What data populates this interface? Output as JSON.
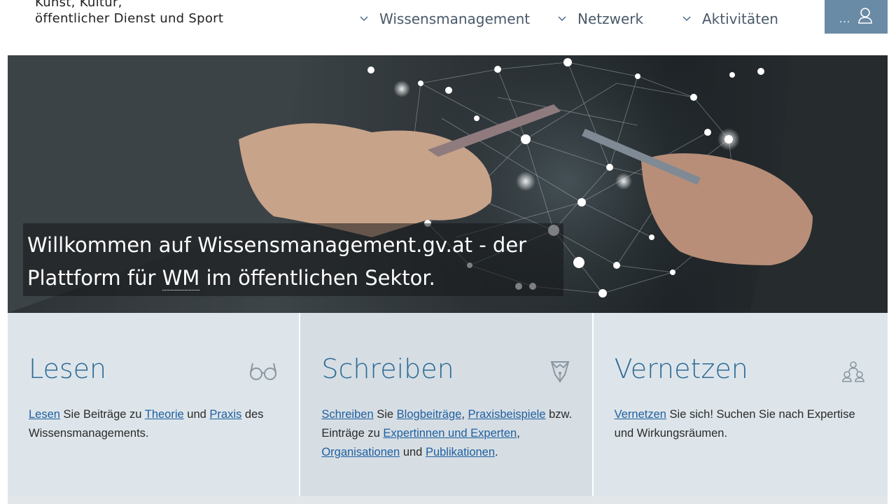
{
  "header": {
    "ministry_line1": "Kunst, Kultur,",
    "ministry_line2": "öffentlicher Dienst und Sport",
    "nav": [
      {
        "label": "Wissensmanagement"
      },
      {
        "label": "Netzwerk"
      },
      {
        "label": "Aktivitäten"
      }
    ],
    "user_menu_dots": "..."
  },
  "hero": {
    "title_part1": "Willkommen auf Wissensmanagement.gv.at - der",
    "title_part2_before": "Plattform für ",
    "title_abbr": "WM",
    "title_part2_after": " im öffentlichen Sektor."
  },
  "cards": [
    {
      "title": "Lesen",
      "icon": "glasses-icon",
      "text": {
        "l1": "Lesen",
        "t1": " Sie Beiträge zu ",
        "l2": "Theorie",
        "t2": " und ",
        "l3": "Praxis",
        "t3": " des Wissensmanagements."
      }
    },
    {
      "title": "Schreiben",
      "icon": "pen-nib-icon",
      "text": {
        "l1": "Schreiben",
        "t1": " Sie ",
        "l2": "Blogbeiträge",
        "t2": ", ",
        "l3": "Praxisbeispiele",
        "t3": " bzw. Einträge zu ",
        "l4": "Expertinnen und Experten",
        "t4": ", ",
        "l5": "Organisationen",
        "t5": " und ",
        "l6": "Publikationen",
        "t6": "."
      }
    },
    {
      "title": "Vernetzen",
      "icon": "network-people-icon",
      "text": {
        "l1": "Vernetzen",
        "t1": " Sie sich! Suchen Sie nach Expertise und Wirkungsräumen."
      }
    }
  ],
  "colors": {
    "accent_blue": "#2e6b96",
    "link_blue": "#1f5fa0",
    "user_button": "#6a8ba6",
    "card_bg": "#dde5ea"
  }
}
